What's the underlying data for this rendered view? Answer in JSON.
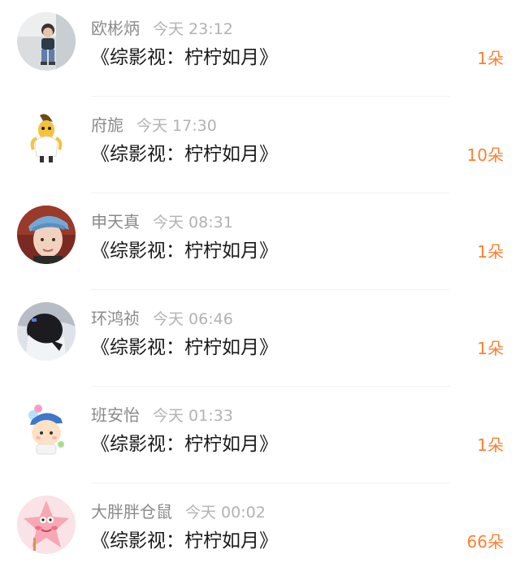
{
  "items": [
    {
      "name": "欧彬炳",
      "time": "今天 23:12",
      "title": "《综影视：柠柠如月》",
      "count": "1朵",
      "avatar_icon": "toddler-photo-avatar"
    },
    {
      "name": "府旎",
      "time": "今天 17:30",
      "title": "《综影视：柠柠如月》",
      "count": "10朵",
      "avatar_icon": "banana-character-avatar"
    },
    {
      "name": "申天真",
      "time": "今天 08:31",
      "title": "《综影视：柠柠如月》",
      "count": "1朵",
      "avatar_icon": "boy-blue-cap-avatar"
    },
    {
      "name": "环鸿祯",
      "time": "今天 06:46",
      "title": "《综影视：柠柠如月》",
      "count": "1朵",
      "avatar_icon": "dark-hair-photo-avatar"
    },
    {
      "name": "班安怡",
      "time": "今天 01:33",
      "title": "《综影视：柠柠如月》",
      "count": "1朵",
      "avatar_icon": "cartoon-child-avatar"
    },
    {
      "name": "大胖胖仓鼠",
      "time": "今天 00:02",
      "title": "《综影视：柠柠如月》",
      "count": "66朵",
      "avatar_icon": "patrick-star-avatar"
    }
  ],
  "colors": {
    "count": "#ff7f32",
    "name": "#8a8a8a",
    "time": "#b2b2b2",
    "title": "#1a1a1a"
  }
}
